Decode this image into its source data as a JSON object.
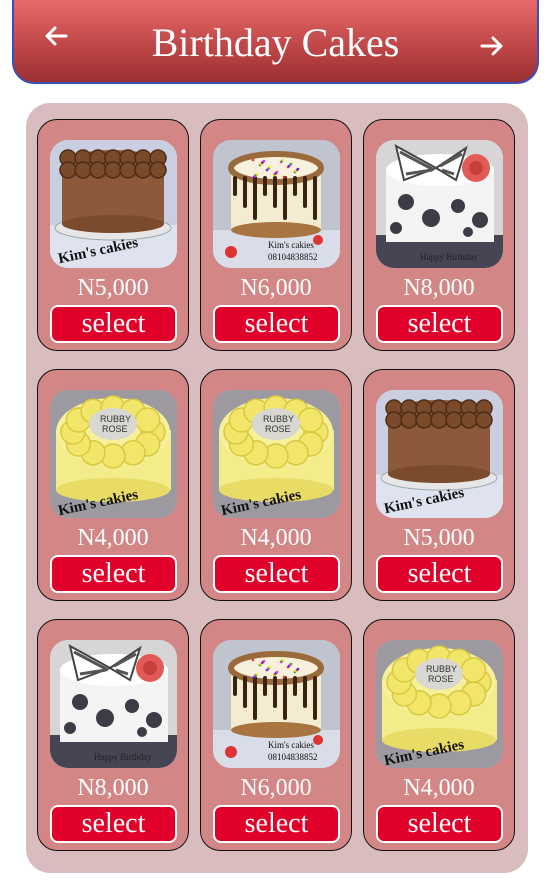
{
  "header": {
    "title": "Birthday Cakes",
    "back_icon": "arrow-left-icon",
    "forward_icon": "arrow-right-icon"
  },
  "cakes": [
    {
      "price": "N5,000",
      "button": "select",
      "image": "chocolate-swirl-cake"
    },
    {
      "price": "N6,000",
      "button": "select",
      "image": "cream-drip-sprinkle-cake"
    },
    {
      "price": "N8,000",
      "button": "select",
      "image": "white-bow-polka-cake"
    },
    {
      "price": "N4,000",
      "button": "select",
      "image": "yellow-rose-cake"
    },
    {
      "price": "N4,000",
      "button": "select",
      "image": "yellow-rose-cake"
    },
    {
      "price": "N5,000",
      "button": "select",
      "image": "chocolate-swirl-cake"
    },
    {
      "price": "N8,000",
      "button": "select",
      "image": "white-bow-polka-cake"
    },
    {
      "price": "N6,000",
      "button": "select",
      "image": "cream-drip-sprinkle-cake"
    },
    {
      "price": "N4,000",
      "button": "select",
      "image": "yellow-rose-cake"
    }
  ],
  "image_watermark": "Kim's cakies",
  "colors": {
    "header_top": "#e86a6a",
    "header_bottom": "#9c2f33",
    "panel": "#d8bcbe",
    "card": "#d28686",
    "button": "#e0002a"
  }
}
